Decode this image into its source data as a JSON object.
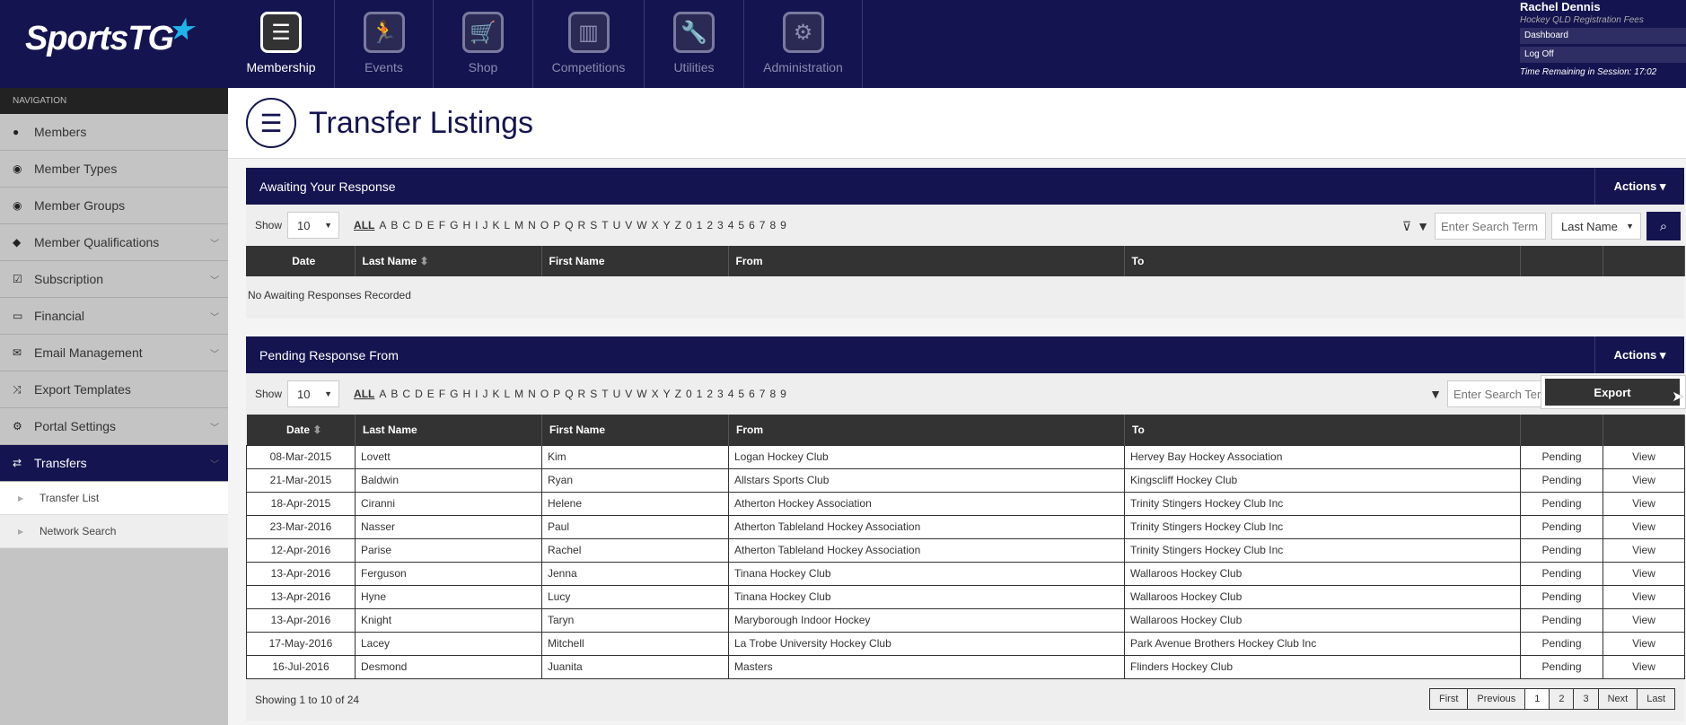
{
  "brand": {
    "logo": "SportsTG"
  },
  "modules": [
    {
      "label": "Membership",
      "icon": "membership-clipboard-icon",
      "active": true
    },
    {
      "label": "Events",
      "icon": "runner-icon"
    },
    {
      "label": "Shop",
      "icon": "cart-icon"
    },
    {
      "label": "Competitions",
      "icon": "podium-icon"
    },
    {
      "label": "Utilities",
      "icon": "wrench-icon"
    },
    {
      "label": "Administration",
      "icon": "gear-icon"
    }
  ],
  "user": {
    "name": "Rachel Dennis",
    "org": "Hockey QLD Registration Fees",
    "dashboard": "Dashboard",
    "logoff": "Log Off",
    "session": "Time Remaining in Session: 17:02"
  },
  "sidebar": {
    "heading": "NAVIGATION",
    "items": [
      {
        "label": "Members",
        "icon": "user-icon"
      },
      {
        "label": "Member Types",
        "icon": "users-icon"
      },
      {
        "label": "Member Groups",
        "icon": "users-icon"
      },
      {
        "label": "Member Qualifications",
        "icon": "tags-icon",
        "expandable": true
      },
      {
        "label": "Subscription",
        "icon": "check-square-icon",
        "expandable": true
      },
      {
        "label": "Financial",
        "icon": "money-icon",
        "expandable": true
      },
      {
        "label": "Email Management",
        "icon": "envelope-icon",
        "expandable": true
      },
      {
        "label": "Export Templates",
        "icon": "shuffle-icon"
      },
      {
        "label": "Portal Settings",
        "icon": "cogs-icon",
        "expandable": true
      },
      {
        "label": "Transfers",
        "icon": "exchange-icon",
        "expandable": true,
        "active": true
      }
    ],
    "subitems": [
      {
        "label": "Transfer List",
        "active": true
      },
      {
        "label": "Network Search"
      }
    ]
  },
  "page": {
    "title": "Transfer Listings"
  },
  "letters": [
    "A",
    "B",
    "C",
    "D",
    "E",
    "F",
    "G",
    "H",
    "I",
    "J",
    "K",
    "L",
    "M",
    "N",
    "O",
    "P",
    "Q",
    "R",
    "S",
    "T",
    "U",
    "V",
    "W",
    "X",
    "Y",
    "Z",
    "0",
    "1",
    "2",
    "3",
    "4",
    "5",
    "6",
    "7",
    "8",
    "9"
  ],
  "awaiting": {
    "title": "Awaiting Your Response",
    "actions": "Actions",
    "show": "Show",
    "show_value": "10",
    "all": "ALL",
    "search_placeholder": "Enter Search Term",
    "search_field": "Last Name",
    "columns": [
      "Date",
      "Last Name",
      "First Name",
      "From",
      "To",
      "",
      ""
    ],
    "empty": "No Awaiting Responses Recorded"
  },
  "pending": {
    "title": "Pending Response From",
    "actions": "Actions",
    "show": "Show",
    "show_value": "10",
    "all": "ALL",
    "search_placeholder": "Enter Search Term",
    "dropdown": {
      "export": "Export"
    },
    "columns": [
      "Date",
      "Last Name",
      "First Name",
      "From",
      "To",
      "",
      ""
    ],
    "rows": [
      [
        "08-Mar-2015",
        "Lovett",
        "Kim",
        "Logan Hockey Club",
        "Hervey Bay Hockey Association",
        "Pending",
        "View"
      ],
      [
        "21-Mar-2015",
        "Baldwin",
        "Ryan",
        "Allstars Sports Club",
        "Kingscliff Hockey Club",
        "Pending",
        "View"
      ],
      [
        "18-Apr-2015",
        "Ciranni",
        "Helene",
        "Atherton Hockey Association",
        "Trinity Stingers Hockey Club Inc",
        "Pending",
        "View"
      ],
      [
        "23-Mar-2016",
        "Nasser",
        "Paul",
        "Atherton Tableland Hockey Association",
        "Trinity Stingers Hockey Club Inc",
        "Pending",
        "View"
      ],
      [
        "12-Apr-2016",
        "Parise",
        "Rachel",
        "Atherton Tableland Hockey Association",
        "Trinity Stingers Hockey Club Inc",
        "Pending",
        "View"
      ],
      [
        "13-Apr-2016",
        "Ferguson",
        "Jenna",
        "Tinana Hockey Club",
        "Wallaroos Hockey Club",
        "Pending",
        "View"
      ],
      [
        "13-Apr-2016",
        "Hyne",
        "Lucy",
        "Tinana Hockey Club",
        "Wallaroos Hockey Club",
        "Pending",
        "View"
      ],
      [
        "13-Apr-2016",
        "Knight",
        "Taryn",
        "Maryborough Indoor Hockey",
        "Wallaroos Hockey Club",
        "Pending",
        "View"
      ],
      [
        "17-May-2016",
        "Lacey",
        "Mitchell",
        "La Trobe University Hockey Club",
        "Park Avenue Brothers Hockey Club Inc",
        "Pending",
        "View"
      ],
      [
        "16-Jul-2016",
        "Desmond",
        "Juanita",
        "Masters",
        "Flinders Hockey Club",
        "Pending",
        "View"
      ]
    ],
    "summary": "Showing 1 to 10 of 24",
    "pager": [
      "First",
      "Previous",
      "1",
      "2",
      "3",
      "Next",
      "Last"
    ],
    "current_page": "1"
  },
  "colors": {
    "navy": "#141450",
    "accent": "#1eb4ea",
    "dark": "#333333"
  }
}
